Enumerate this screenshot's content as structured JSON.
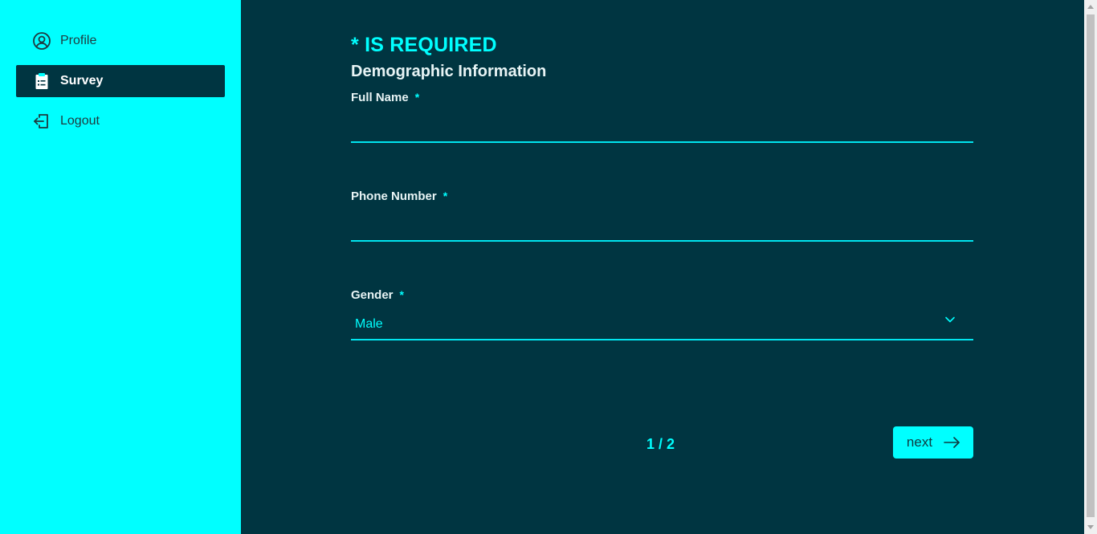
{
  "sidebar": {
    "items": [
      {
        "label": "Profile",
        "icon": "user-circle-icon",
        "active": false
      },
      {
        "label": "Survey",
        "icon": "clipboard-icon",
        "active": true
      },
      {
        "label": "Logout",
        "icon": "logout-icon",
        "active": false
      }
    ]
  },
  "form": {
    "required_note": "* IS REQUIRED",
    "section_title": "Demographic Information",
    "required_marker": "*",
    "fields": {
      "full_name": {
        "label": "Full Name",
        "value": ""
      },
      "phone": {
        "label": "Phone Number",
        "value": ""
      },
      "gender": {
        "label": "Gender",
        "value": "Male"
      }
    }
  },
  "pager": {
    "text": "1 / 2"
  },
  "next_button": {
    "label": "next"
  },
  "colors": {
    "accent": "#00ffff",
    "background": "#003541",
    "sidebar": "#00ffff",
    "active_item": "#003541"
  }
}
